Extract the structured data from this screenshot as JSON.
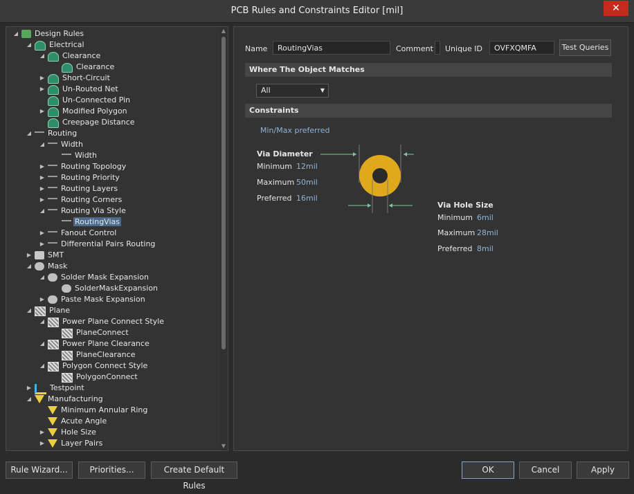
{
  "window": {
    "title": "PCB Rules and Constraints Editor [mil]",
    "close": "✕"
  },
  "tree": [
    {
      "label": "Design Rules",
      "level": 0,
      "icon": "rules",
      "exp": "down"
    },
    {
      "label": "Electrical",
      "level": 1,
      "icon": "elec",
      "exp": "down"
    },
    {
      "label": "Clearance",
      "level": 2,
      "icon": "elec",
      "exp": "down"
    },
    {
      "label": "Clearance",
      "level": 3,
      "icon": "elec",
      "exp": ""
    },
    {
      "label": "Short-Circuit",
      "level": 2,
      "icon": "elec",
      "exp": "right"
    },
    {
      "label": "Un-Routed Net",
      "level": 2,
      "icon": "elec",
      "exp": "right"
    },
    {
      "label": "Un-Connected Pin",
      "level": 2,
      "icon": "elec",
      "exp": ""
    },
    {
      "label": "Modified Polygon",
      "level": 2,
      "icon": "elec",
      "exp": "right"
    },
    {
      "label": "Creepage Distance",
      "level": 2,
      "icon": "elec",
      "exp": ""
    },
    {
      "label": "Routing",
      "level": 1,
      "icon": "route",
      "exp": "down"
    },
    {
      "label": "Width",
      "level": 2,
      "icon": "route",
      "exp": "down"
    },
    {
      "label": "Width",
      "level": 3,
      "icon": "route",
      "exp": ""
    },
    {
      "label": "Routing Topology",
      "level": 2,
      "icon": "route",
      "exp": "right"
    },
    {
      "label": "Routing Priority",
      "level": 2,
      "icon": "route",
      "exp": "right"
    },
    {
      "label": "Routing Layers",
      "level": 2,
      "icon": "route",
      "exp": "right"
    },
    {
      "label": "Routing Corners",
      "level": 2,
      "icon": "route",
      "exp": "right"
    },
    {
      "label": "Routing Via Style",
      "level": 2,
      "icon": "route",
      "exp": "down"
    },
    {
      "label": "RoutingVias",
      "level": 3,
      "icon": "route",
      "exp": "",
      "selected": true
    },
    {
      "label": "Fanout Control",
      "level": 2,
      "icon": "route",
      "exp": "right"
    },
    {
      "label": "Differential Pairs Routing",
      "level": 2,
      "icon": "route",
      "exp": "right"
    },
    {
      "label": "SMT",
      "level": 1,
      "icon": "smt",
      "exp": "right"
    },
    {
      "label": "Mask",
      "level": 1,
      "icon": "mask",
      "exp": "down"
    },
    {
      "label": "Solder Mask Expansion",
      "level": 2,
      "icon": "mask",
      "exp": "down"
    },
    {
      "label": "SolderMaskExpansion",
      "level": 3,
      "icon": "mask",
      "exp": ""
    },
    {
      "label": "Paste Mask Expansion",
      "level": 2,
      "icon": "mask",
      "exp": "right"
    },
    {
      "label": "Plane",
      "level": 1,
      "icon": "plane",
      "exp": "down"
    },
    {
      "label": "Power Plane Connect Style",
      "level": 2,
      "icon": "plane",
      "exp": "down"
    },
    {
      "label": "PlaneConnect",
      "level": 3,
      "icon": "plane",
      "exp": ""
    },
    {
      "label": "Power Plane Clearance",
      "level": 2,
      "icon": "plane",
      "exp": "down"
    },
    {
      "label": "PlaneClearance",
      "level": 3,
      "icon": "plane",
      "exp": ""
    },
    {
      "label": "Polygon Connect Style",
      "level": 2,
      "icon": "plane",
      "exp": "down"
    },
    {
      "label": "PolygonConnect",
      "level": 3,
      "icon": "plane",
      "exp": ""
    },
    {
      "label": "Testpoint",
      "level": 1,
      "icon": "test",
      "exp": "right"
    },
    {
      "label": "Manufacturing",
      "level": 1,
      "icon": "mfg",
      "exp": "down"
    },
    {
      "label": "Minimum Annular Ring",
      "level": 2,
      "icon": "mfg",
      "exp": ""
    },
    {
      "label": "Acute Angle",
      "level": 2,
      "icon": "mfg",
      "exp": ""
    },
    {
      "label": "Hole Size",
      "level": 2,
      "icon": "mfg",
      "exp": "right"
    },
    {
      "label": "Layer Pairs",
      "level": 2,
      "icon": "mfg",
      "exp": "right"
    }
  ],
  "rule": {
    "name_label": "Name",
    "name": "RoutingVias",
    "comment_label": "Comment",
    "comment": "",
    "uid_label": "Unique ID",
    "uid": "OVFXQMFA",
    "test_queries": "Test Queries"
  },
  "match": {
    "header": "Where The Object Matches",
    "selected": "All"
  },
  "constraints": {
    "header": "Constraints",
    "mode": "Min/Max preferred",
    "via_diameter": {
      "title": "Via Diameter",
      "min_label": "Minimum",
      "min": "12mil",
      "max_label": "Maximum",
      "max": "50mil",
      "pref_label": "Preferred",
      "pref": "16mil"
    },
    "via_hole": {
      "title": "Via Hole Size",
      "min_label": "Minimum",
      "min": "6mil",
      "max_label": "Maximum",
      "max": "28mil",
      "pref_label": "Preferred",
      "pref": "8mil"
    },
    "colors": {
      "via_ring": "#e0a81c",
      "via_hole": "#2b2b2b",
      "arrow": "#7fc8a0"
    }
  },
  "footer": {
    "rule_wizard": "Rule Wizard...",
    "priorities": "Priorities...",
    "create_default": "Create Default Rules",
    "ok": "OK",
    "cancel": "Cancel",
    "apply": "Apply"
  }
}
